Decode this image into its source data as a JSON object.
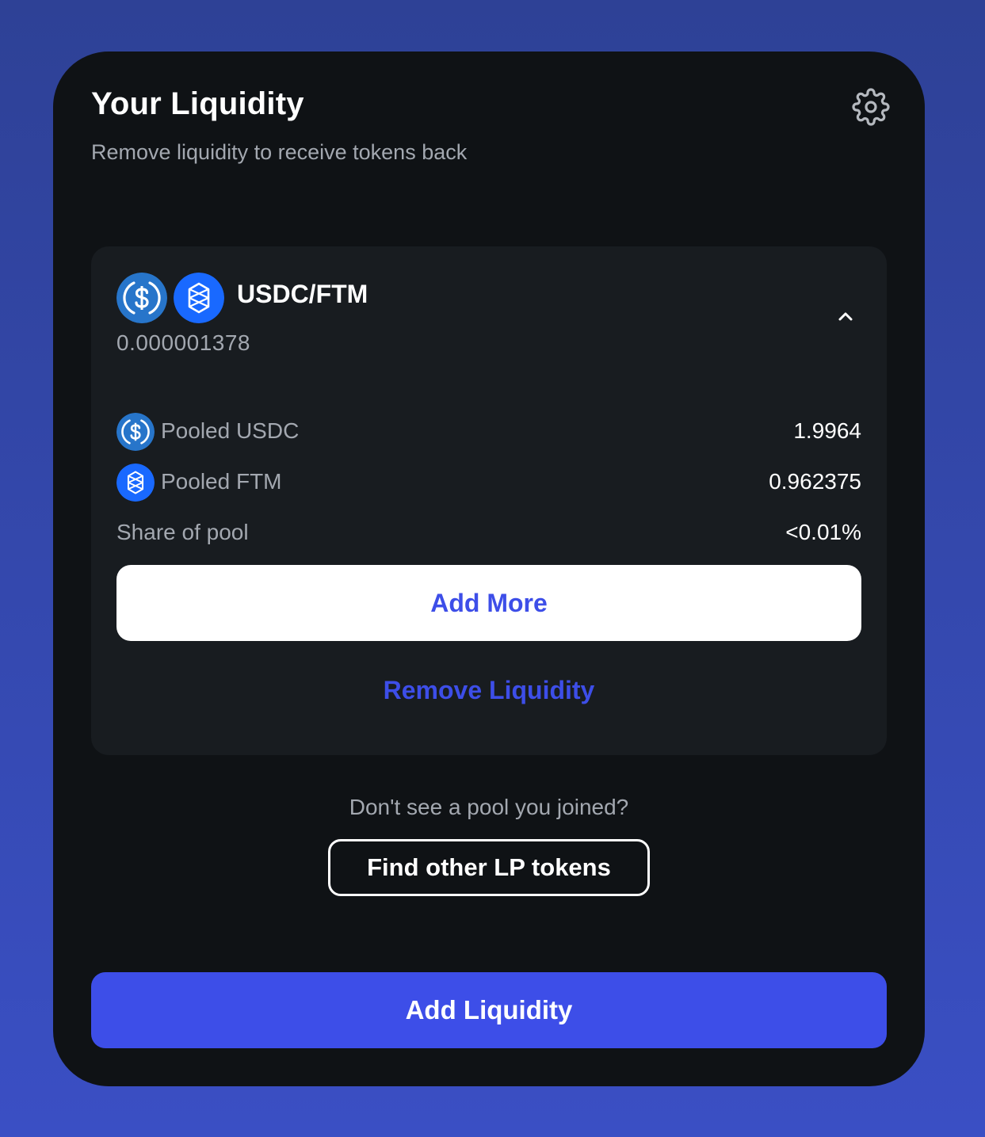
{
  "header": {
    "title": "Your Liquidity",
    "subtitle": "Remove liquidity to receive tokens back",
    "settings_icon": "gear-icon"
  },
  "pool": {
    "pair_name": "USDC/FTM",
    "lp_balance": "0.000001378",
    "token_a_icon": "usdc-icon",
    "token_b_icon": "ftm-icon",
    "expand_icon": "chevron-up-icon",
    "rows": [
      {
        "label": "Pooled USDC",
        "value": "1.9964",
        "icon": "usdc-icon"
      },
      {
        "label": "Pooled FTM",
        "value": "0.962375",
        "icon": "ftm-icon"
      },
      {
        "label": "Share of pool",
        "value": "<0.01%"
      }
    ],
    "add_more_label": "Add More",
    "remove_label": "Remove Liquidity"
  },
  "footer": {
    "hint": "Don't see a pool you joined?",
    "find_label": "Find other LP tokens",
    "add_liquidity_label": "Add Liquidity"
  },
  "colors": {
    "background": "#3a4fc4",
    "card": "#0f1215",
    "pool_card": "#181c20",
    "accent": "#3d4ee8",
    "usdc": "#2775ca",
    "ftm": "#1969ff"
  }
}
